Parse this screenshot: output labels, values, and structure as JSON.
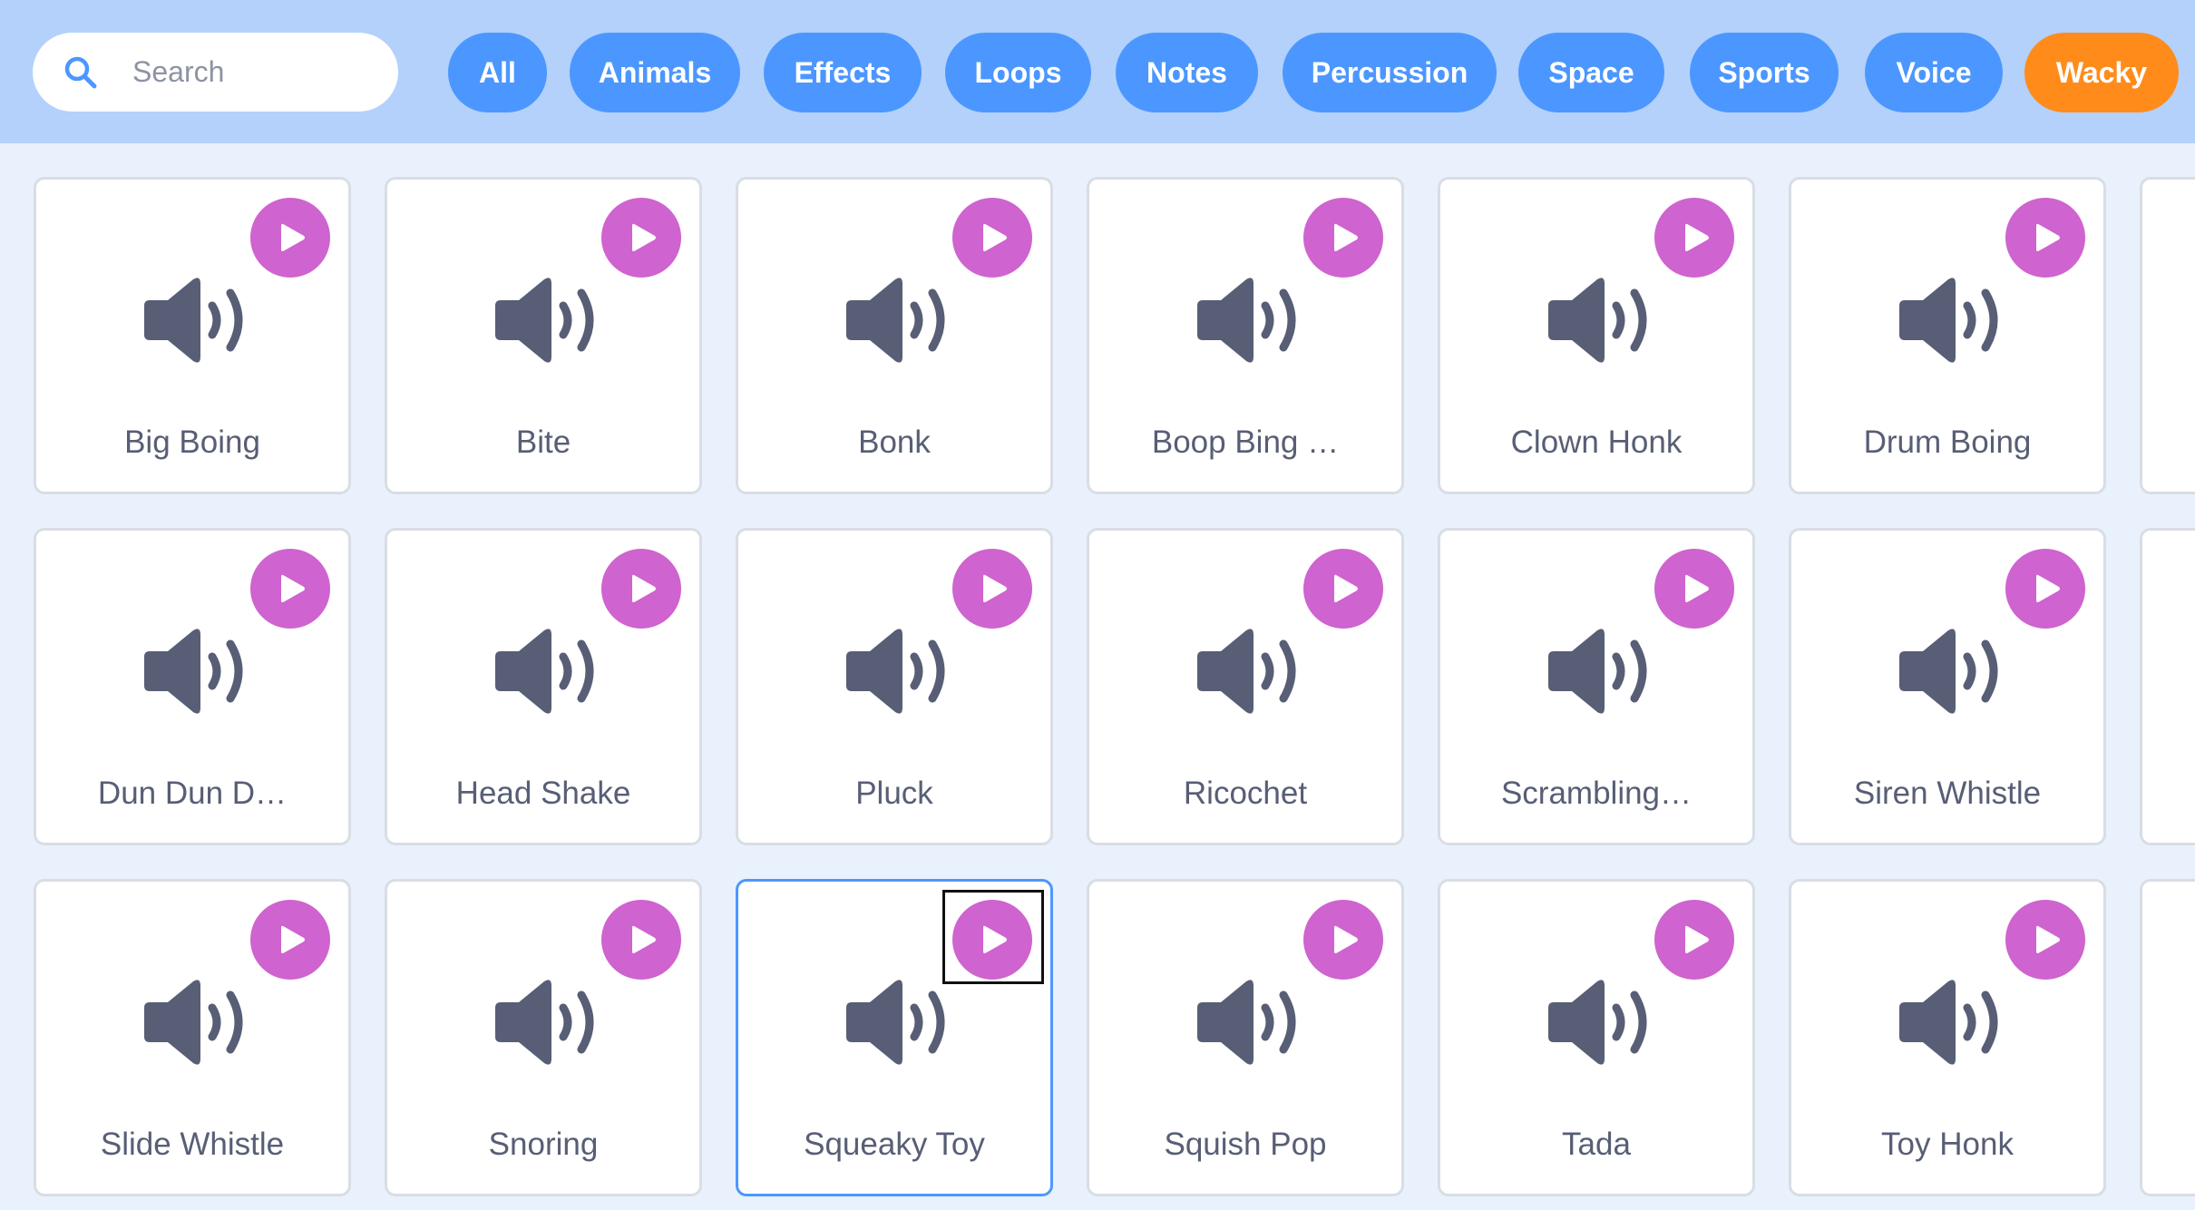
{
  "search": {
    "placeholder": "Search",
    "value": ""
  },
  "categories": [
    "All",
    "Animals",
    "Effects",
    "Loops",
    "Notes",
    "Percussion",
    "Space",
    "Sports",
    "Voice",
    "Wacky"
  ],
  "selected_category": "Wacky",
  "sounds": [
    "Big Boing",
    "Bite",
    "Bonk",
    "Boop Bing …",
    "Clown Honk",
    "Drum Boing",
    "Dun Dun D…",
    "Head Shake",
    "Pluck",
    "Ricochet",
    "Scrambling…",
    "Siren Whistle",
    "Slide Whistle",
    "Snoring",
    "Squeaky Toy",
    "Squish Pop",
    "Tada",
    "Toy Honk"
  ],
  "selected_sound": "Squeaky Toy",
  "icons": {
    "search": "search-icon",
    "play": "play-icon",
    "sound": "speaker-icon"
  },
  "colors": {
    "topbar": "#b3d1fa",
    "chip": "#4c97ff",
    "chip_active": "#ff8c1a",
    "play": "#cf63cf",
    "selected_border": "#4c97ff",
    "label": "#575e75"
  }
}
